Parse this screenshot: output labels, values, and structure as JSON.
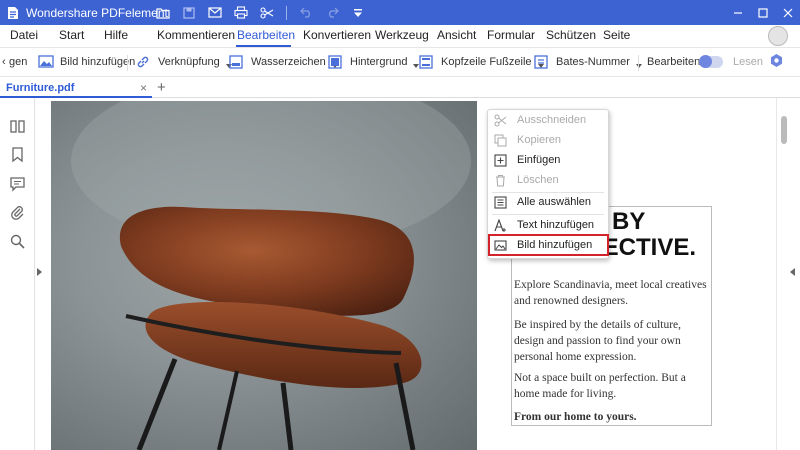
{
  "app": {
    "title": "Wondershare PDFelement",
    "accent_color": "#3d63d3"
  },
  "titlebar_icons": [
    "folder-icon",
    "save-icon",
    "mail-icon",
    "print-icon",
    "scissors-icon",
    "undo-icon",
    "redo-icon",
    "dropdown-icon"
  ],
  "window_controls": [
    "minimize-icon",
    "maximize-icon",
    "close-icon"
  ],
  "menu": {
    "items": [
      "Datei",
      "Start",
      "Hilfe",
      "Kommentieren",
      "Bearbeiten",
      "Konvertieren",
      "Werkzeug",
      "Ansicht",
      "Formular",
      "Schützen",
      "Seite"
    ],
    "active": "Bearbeiten"
  },
  "toolbar": {
    "scroll_left": "‹",
    "partial_label": "gen",
    "add_image": "Bild hinzufügen",
    "link": "Verknüpfung",
    "watermark": "Wasserzeichen",
    "background": "Hintergrund",
    "header": "Kopfzeile",
    "footer": "Fußzeile",
    "bates": "Bates-Nummer",
    "edit_mode": "Bearbeiten",
    "read_mode": "Lesen"
  },
  "tab": {
    "filename": "Furniture.pdf",
    "close": "×",
    "add": "+"
  },
  "sidebar_icons": [
    "thumbnails-icon",
    "bookmark-icon",
    "comment-icon",
    "attachment-icon",
    "search-icon"
  ],
  "document": {
    "headline_line1": "D BY",
    "headline_line2": "LECTIVE.",
    "para1": "Explore Scandinavia, meet local creatives and renowned designers.",
    "para2": "Be inspired by the details of culture, design and passion to find your own personal home expression.",
    "para3": "Not a space built on perfection. But a home made for living.",
    "para4": "From our home to yours."
  },
  "context_menu": {
    "cut": "Ausschneiden",
    "copy": "Kopieren",
    "paste": "Einfügen",
    "delete": "Löschen",
    "select_all": "Alle auswählen",
    "add_text": "Text hinzufügen",
    "add_image": "Bild hinzufügen",
    "highlight_color": "#d2232a"
  }
}
